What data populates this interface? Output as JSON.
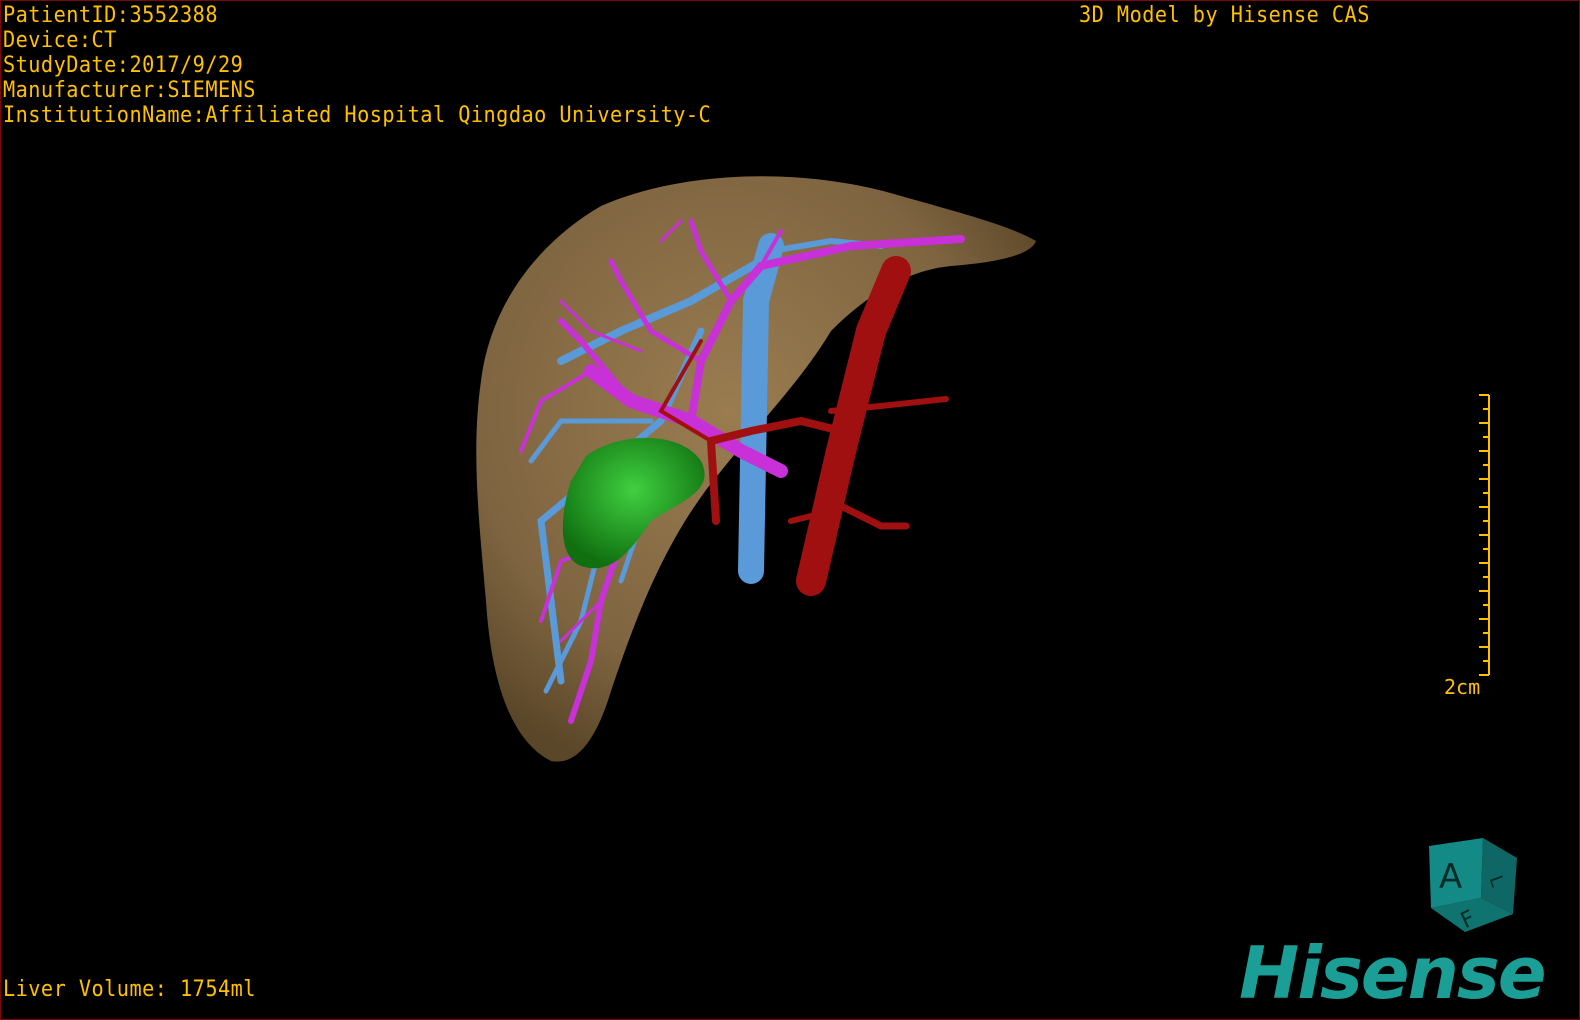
{
  "patient_info": {
    "patient_id": "PatientID:3552388",
    "device": "Device:CT",
    "study_date": "StudyDate:2017/9/29",
    "manufacturer": "Manufacturer:SIEMENS",
    "institution": "InstitutionName:Affiliated Hospital Qingdao University-C"
  },
  "model_credit": "3D Model by Hisense CAS",
  "liver_volume": "Liver Volume: 1754ml",
  "scale_bar": {
    "label": "2cm"
  },
  "orientation_cube": {
    "faces": [
      "A",
      "F",
      "L"
    ]
  },
  "logo": "Hisense",
  "colors": {
    "overlay_text": "#ffc000",
    "liver": "#8a6e45",
    "portal_vein": "#c830d8",
    "hepatic_vein": "#5a9ad8",
    "artery": "#a01010",
    "lesion": "#1fa51f",
    "brand": "#1a9e95"
  }
}
